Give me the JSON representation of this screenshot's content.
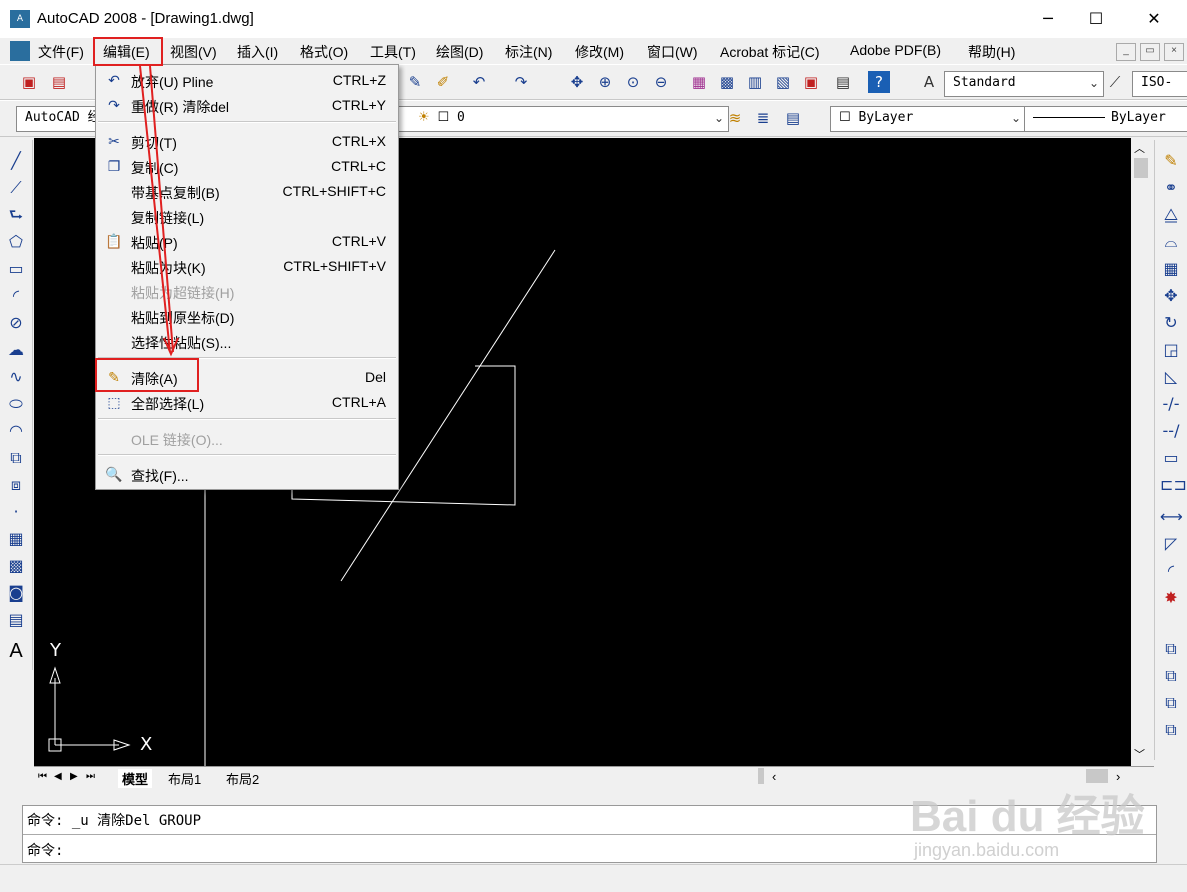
{
  "window": {
    "title": "AutoCAD 2008 - [Drawing1.dwg]",
    "app_icon_text": "A",
    "minimize_glyph": "─",
    "maximize_glyph": "☐",
    "close_glyph": "✕"
  },
  "menubar": {
    "items": [
      "文件(F)",
      "编辑(E)",
      "视图(V)",
      "插入(I)",
      "格式(O)",
      "工具(T)",
      "绘图(D)",
      "标注(N)",
      "修改(M)",
      "窗口(W)",
      "Acrobat 标记(C)",
      "Adobe PDF(B)",
      "帮助(H)"
    ],
    "mdi_min": "_",
    "mdi_restore": "▭",
    "mdi_close": "×"
  },
  "toolbar1": {
    "text_style": "Standard",
    "dim_style": "ISO-"
  },
  "toolbar2": {
    "workspace": "AutoCAD 经",
    "layer_value": "0",
    "color": "ByLayer",
    "linetype": "ByLayer"
  },
  "edit_menu": {
    "items": [
      {
        "icon": "undo-icon",
        "glyph": "↶",
        "label": "放弃(U) Pline",
        "shortcut": "CTRL+Z",
        "enabled": true
      },
      {
        "icon": "redo-icon",
        "glyph": "↷",
        "label": "重做(R) 清除del",
        "shortcut": "CTRL+Y",
        "enabled": true
      },
      {
        "icon": "cut-icon",
        "glyph": "✂",
        "label": "剪切(T)",
        "shortcut": "CTRL+X",
        "enabled": true
      },
      {
        "icon": "copy-icon",
        "glyph": "❐",
        "label": "复制(C)",
        "shortcut": "CTRL+C",
        "enabled": true
      },
      {
        "icon": "",
        "glyph": "",
        "label": "带基点复制(B)",
        "shortcut": "CTRL+SHIFT+C",
        "enabled": true
      },
      {
        "icon": "",
        "glyph": "",
        "label": "复制链接(L)",
        "shortcut": "",
        "enabled": true
      },
      {
        "icon": "paste-icon",
        "glyph": "📋",
        "label": "粘贴(P)",
        "shortcut": "CTRL+V",
        "enabled": true
      },
      {
        "icon": "",
        "glyph": "",
        "label": "粘贴为块(K)",
        "shortcut": "CTRL+SHIFT+V",
        "enabled": true
      },
      {
        "icon": "",
        "glyph": "",
        "label": "粘贴为超链接(H)",
        "shortcut": "",
        "enabled": false
      },
      {
        "icon": "",
        "glyph": "",
        "label": "粘贴到原坐标(D)",
        "shortcut": "",
        "enabled": true
      },
      {
        "icon": "",
        "glyph": "",
        "label": "选择性粘贴(S)...",
        "shortcut": "",
        "enabled": true
      },
      {
        "icon": "erase-icon",
        "glyph": "✎",
        "label": "清除(A)",
        "shortcut": "Del",
        "enabled": true
      },
      {
        "icon": "select-all-icon",
        "glyph": "⬚",
        "label": "全部选择(L)",
        "shortcut": "CTRL+A",
        "enabled": true
      },
      {
        "icon": "",
        "glyph": "",
        "label": "OLE 链接(O)...",
        "shortcut": "",
        "enabled": false
      },
      {
        "icon": "find-icon",
        "glyph": "🔍",
        "label": "查找(F)...",
        "shortcut": "",
        "enabled": true
      }
    ]
  },
  "canvas": {
    "ucs_x": "X",
    "ucs_y": "Y"
  },
  "layout_tabs": [
    "模型",
    "布局1",
    "布局2"
  ],
  "command": {
    "history": "命令: _u 清除Del GROUP",
    "prompt": "命令:"
  },
  "watermark": {
    "brand": "Bai du 经验",
    "url": "jingyan.baidu.com"
  },
  "colors": {
    "highlight_box": "#e02020",
    "canvas_bg": "#000000",
    "drawing_lines": "#ffffff"
  }
}
